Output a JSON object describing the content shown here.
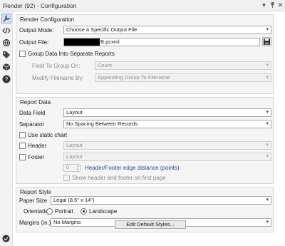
{
  "window": {
    "title": "Render (92) - Configuration",
    "menu_glyph": "▾",
    "pin_glyph": "📌",
    "close_glyph": "✕"
  },
  "sidebar": {
    "icons": [
      "wrench-icon",
      "code-icon",
      "globe-icon",
      "tag-icon",
      "box-icon",
      "help-icon"
    ]
  },
  "render_config": {
    "title": "Render Configuration",
    "output_mode_label": "Output Mode:",
    "output_mode_value": "Choose a Specific Output File",
    "output_file_label": "Output File:",
    "output_file_value": "B.pcxml",
    "group_data_label": "Group Data Into Separate Reports",
    "field_to_group_label": "Field To Group On:",
    "field_to_group_value": "Count",
    "modify_filename_label": "Modify Filename By:",
    "modify_filename_value": "Appending Group To Filename"
  },
  "report_data": {
    "title": "Report Data",
    "data_field_label": "Data Field",
    "data_field_value": "Layout",
    "separator_label": "Separator",
    "separator_value": "No Spacing Between Records",
    "static_chart_label": "Use static chart",
    "header_label": "Header",
    "header_value": "Layout",
    "footer_label": "Footer",
    "footer_value": "Layout",
    "edge_distance_value": "0",
    "edge_distance_label": "Header/Footer edge distance (points)",
    "show_first_page_label": "Show header and footer on first page"
  },
  "report_style": {
    "title": "Report Style",
    "paper_size_label": "Paper Size",
    "paper_size_value": "Legal (8.5\" x 14\")",
    "orientation_label": "Orientation",
    "portrait_label": "Portrait",
    "landscape_label": "Landscape",
    "orientation_selected": "Landscape",
    "margins_label": "Margins (in.)",
    "margins_value": "No Margins",
    "edit_styles_label": "Edit Default Styles..."
  },
  "colors": {
    "accent_blue": "#1f4e8c",
    "status_green": "#2e7d32"
  }
}
